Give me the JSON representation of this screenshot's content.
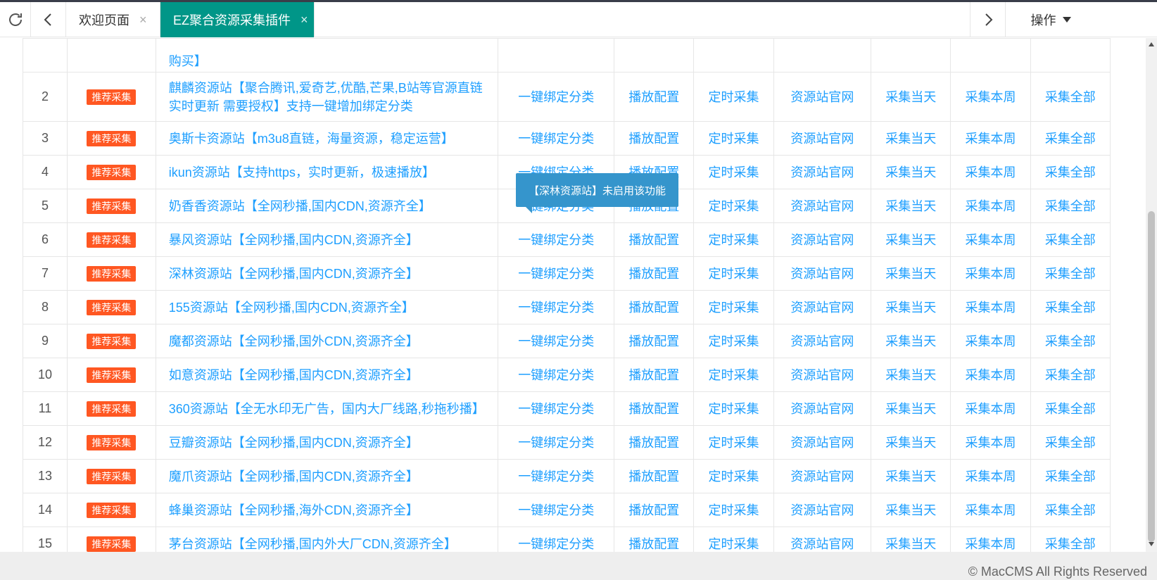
{
  "tabs": {
    "refresh_icon": "refresh-icon",
    "prev_icon": "chevron-left-icon",
    "next_icon": "chevron-right-icon",
    "items": [
      {
        "label": "欢迎页面",
        "active": false
      },
      {
        "label": "EZ聚合资源采集插件",
        "active": true
      }
    ],
    "close_glyph": "×",
    "operate_label": "操作"
  },
  "table": {
    "tag_label": "推荐采集",
    "ops": [
      "一键绑定分类",
      "播放配置",
      "定时采集",
      "资源站官网",
      "采集当天",
      "采集本周",
      "采集全部"
    ],
    "partial_row_name": "购买】",
    "rows": [
      {
        "no": "2",
        "name": "麒麟资源站【聚合腾讯,爱奇艺,优酷,芒果,B站等官源直链实时更新 需要授权】支持一键增加绑定分类"
      },
      {
        "no": "3",
        "name": "奥斯卡资源站【m3u8直链，海量资源，稳定运营】"
      },
      {
        "no": "4",
        "name": "ikun资源站【支持https，实时更新，极速播放】"
      },
      {
        "no": "5",
        "name": "奶香香资源站【全网秒播,国内CDN,资源齐全】"
      },
      {
        "no": "6",
        "name": "暴风资源站【全网秒播,国内CDN,资源齐全】"
      },
      {
        "no": "7",
        "name": "深林资源站【全网秒播,国内CDN,资源齐全】"
      },
      {
        "no": "8",
        "name": "155资源站【全网秒播,国内CDN,资源齐全】"
      },
      {
        "no": "9",
        "name": "魔都资源站【全网秒播,国外CDN,资源齐全】"
      },
      {
        "no": "10",
        "name": "如意资源站【全网秒播,国内CDN,资源齐全】"
      },
      {
        "no": "11",
        "name": "360资源站【全无水印无广告，国内大厂线路,秒拖秒播】"
      },
      {
        "no": "12",
        "name": "豆瓣资源站【全网秒播,国内CDN,资源齐全】"
      },
      {
        "no": "13",
        "name": "魔爪资源站【全网秒播,国内CDN,资源齐全】"
      },
      {
        "no": "14",
        "name": "蜂巢资源站【全网秒播,海外CDN,资源齐全】"
      },
      {
        "no": "15",
        "name": "茅台资源站【全网秒播,国内外大厂CDN,资源齐全】"
      }
    ]
  },
  "tooltip": {
    "text": "【深林资源站】未启用该功能"
  },
  "footer": {
    "text": "© MacCMS All Rights Reserved"
  },
  "colors": {
    "accent": "#009688",
    "link": "#1e9fff",
    "tag": "#ff5722",
    "tooltip": "#3595cc"
  }
}
